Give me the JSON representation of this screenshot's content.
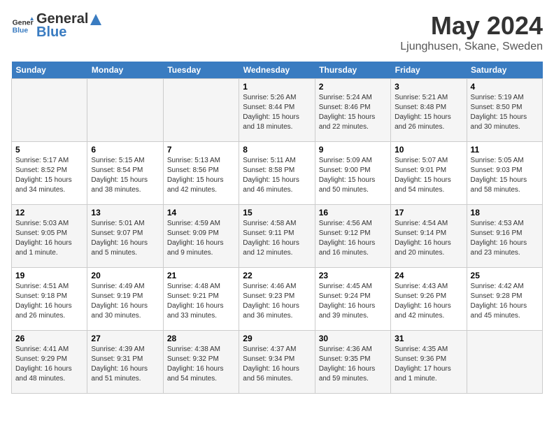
{
  "header": {
    "logo": {
      "general": "General",
      "blue": "Blue"
    },
    "month": "May 2024",
    "location": "Ljunghusen, Skane, Sweden"
  },
  "weekdays": [
    "Sunday",
    "Monday",
    "Tuesday",
    "Wednesday",
    "Thursday",
    "Friday",
    "Saturday"
  ],
  "weeks": [
    [
      {
        "day": "",
        "info": ""
      },
      {
        "day": "",
        "info": ""
      },
      {
        "day": "",
        "info": ""
      },
      {
        "day": "1",
        "info": "Sunrise: 5:26 AM\nSunset: 8:44 PM\nDaylight: 15 hours\nand 18 minutes."
      },
      {
        "day": "2",
        "info": "Sunrise: 5:24 AM\nSunset: 8:46 PM\nDaylight: 15 hours\nand 22 minutes."
      },
      {
        "day": "3",
        "info": "Sunrise: 5:21 AM\nSunset: 8:48 PM\nDaylight: 15 hours\nand 26 minutes."
      },
      {
        "day": "4",
        "info": "Sunrise: 5:19 AM\nSunset: 8:50 PM\nDaylight: 15 hours\nand 30 minutes."
      }
    ],
    [
      {
        "day": "5",
        "info": "Sunrise: 5:17 AM\nSunset: 8:52 PM\nDaylight: 15 hours\nand 34 minutes."
      },
      {
        "day": "6",
        "info": "Sunrise: 5:15 AM\nSunset: 8:54 PM\nDaylight: 15 hours\nand 38 minutes."
      },
      {
        "day": "7",
        "info": "Sunrise: 5:13 AM\nSunset: 8:56 PM\nDaylight: 15 hours\nand 42 minutes."
      },
      {
        "day": "8",
        "info": "Sunrise: 5:11 AM\nSunset: 8:58 PM\nDaylight: 15 hours\nand 46 minutes."
      },
      {
        "day": "9",
        "info": "Sunrise: 5:09 AM\nSunset: 9:00 PM\nDaylight: 15 hours\nand 50 minutes."
      },
      {
        "day": "10",
        "info": "Sunrise: 5:07 AM\nSunset: 9:01 PM\nDaylight: 15 hours\nand 54 minutes."
      },
      {
        "day": "11",
        "info": "Sunrise: 5:05 AM\nSunset: 9:03 PM\nDaylight: 15 hours\nand 58 minutes."
      }
    ],
    [
      {
        "day": "12",
        "info": "Sunrise: 5:03 AM\nSunset: 9:05 PM\nDaylight: 16 hours\nand 1 minute."
      },
      {
        "day": "13",
        "info": "Sunrise: 5:01 AM\nSunset: 9:07 PM\nDaylight: 16 hours\nand 5 minutes."
      },
      {
        "day": "14",
        "info": "Sunrise: 4:59 AM\nSunset: 9:09 PM\nDaylight: 16 hours\nand 9 minutes."
      },
      {
        "day": "15",
        "info": "Sunrise: 4:58 AM\nSunset: 9:11 PM\nDaylight: 16 hours\nand 12 minutes."
      },
      {
        "day": "16",
        "info": "Sunrise: 4:56 AM\nSunset: 9:12 PM\nDaylight: 16 hours\nand 16 minutes."
      },
      {
        "day": "17",
        "info": "Sunrise: 4:54 AM\nSunset: 9:14 PM\nDaylight: 16 hours\nand 20 minutes."
      },
      {
        "day": "18",
        "info": "Sunrise: 4:53 AM\nSunset: 9:16 PM\nDaylight: 16 hours\nand 23 minutes."
      }
    ],
    [
      {
        "day": "19",
        "info": "Sunrise: 4:51 AM\nSunset: 9:18 PM\nDaylight: 16 hours\nand 26 minutes."
      },
      {
        "day": "20",
        "info": "Sunrise: 4:49 AM\nSunset: 9:19 PM\nDaylight: 16 hours\nand 30 minutes."
      },
      {
        "day": "21",
        "info": "Sunrise: 4:48 AM\nSunset: 9:21 PM\nDaylight: 16 hours\nand 33 minutes."
      },
      {
        "day": "22",
        "info": "Sunrise: 4:46 AM\nSunset: 9:23 PM\nDaylight: 16 hours\nand 36 minutes."
      },
      {
        "day": "23",
        "info": "Sunrise: 4:45 AM\nSunset: 9:24 PM\nDaylight: 16 hours\nand 39 minutes."
      },
      {
        "day": "24",
        "info": "Sunrise: 4:43 AM\nSunset: 9:26 PM\nDaylight: 16 hours\nand 42 minutes."
      },
      {
        "day": "25",
        "info": "Sunrise: 4:42 AM\nSunset: 9:28 PM\nDaylight: 16 hours\nand 45 minutes."
      }
    ],
    [
      {
        "day": "26",
        "info": "Sunrise: 4:41 AM\nSunset: 9:29 PM\nDaylight: 16 hours\nand 48 minutes."
      },
      {
        "day": "27",
        "info": "Sunrise: 4:39 AM\nSunset: 9:31 PM\nDaylight: 16 hours\nand 51 minutes."
      },
      {
        "day": "28",
        "info": "Sunrise: 4:38 AM\nSunset: 9:32 PM\nDaylight: 16 hours\nand 54 minutes."
      },
      {
        "day": "29",
        "info": "Sunrise: 4:37 AM\nSunset: 9:34 PM\nDaylight: 16 hours\nand 56 minutes."
      },
      {
        "day": "30",
        "info": "Sunrise: 4:36 AM\nSunset: 9:35 PM\nDaylight: 16 hours\nand 59 minutes."
      },
      {
        "day": "31",
        "info": "Sunrise: 4:35 AM\nSunset: 9:36 PM\nDaylight: 17 hours\nand 1 minute."
      },
      {
        "day": "",
        "info": ""
      }
    ]
  ]
}
